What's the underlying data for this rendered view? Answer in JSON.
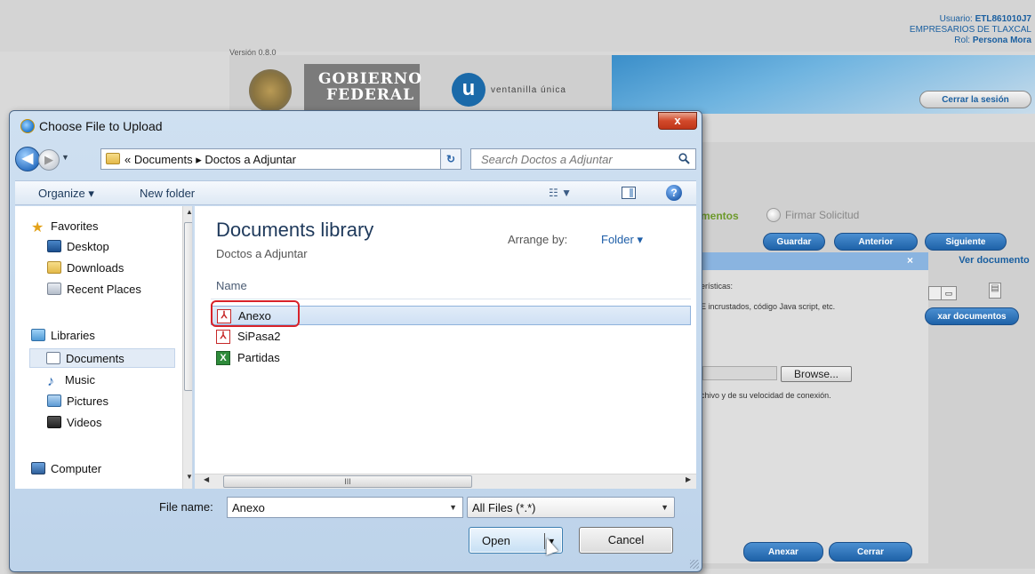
{
  "background": {
    "user_line": "Usuario: ",
    "user_id": "ETL861010J7",
    "company": "EMPRESARIOS DE TLAXCAL",
    "role_label": "Rol: ",
    "role_value": "Persona Mora",
    "version": "Versión 0.8.0",
    "brand_gob_1": "GOBIERNO",
    "brand_gob_2": "FEDERAL",
    "brand_vu_letter": "u",
    "brand_vu_text": "ventanilla única",
    "logout_label": "Cerrar la sesión",
    "step_docs": "mentos",
    "step_firmar": "Firmar Solicitud",
    "btn_guardar": "Guardar",
    "btn_anterior": "Anterior",
    "btn_siguiente": "Siguiente",
    "modal_close": "×",
    "ver_documento": "Ver documento",
    "text_caracteristicas": "erísticas:",
    "text_incrustados": "E incrustados, código Java script, etc.",
    "btn_adjuntar": "xar documentos",
    "browse_label": "Browse...",
    "text_velocidad": "chivo y de su velocidad de conexión.",
    "btn_anexar": "Anexar",
    "btn_cerrar": "Cerrar"
  },
  "dialog": {
    "title": "Choose File to Upload",
    "close_glyph": "x",
    "address_text": "«  Documents  ▸  Doctos a Adjuntar",
    "search_placeholder": "Search Doctos a Adjuntar",
    "toolbar": {
      "organize": "Organize ▾",
      "new_folder": "New folder"
    },
    "nav": [
      {
        "label": "Favorites",
        "icon": "star-icon"
      },
      {
        "label": "Desktop",
        "icon": "desktop-icon"
      },
      {
        "label": "Downloads",
        "icon": "downloads-folder-icon"
      },
      {
        "label": "Recent Places",
        "icon": "recent-places-icon"
      },
      {
        "label": "Libraries",
        "icon": "libraries-icon"
      },
      {
        "label": "Documents",
        "icon": "documents-icon"
      },
      {
        "label": "Music",
        "icon": "music-icon"
      },
      {
        "label": "Pictures",
        "icon": "pictures-icon"
      },
      {
        "label": "Videos",
        "icon": "videos-icon"
      },
      {
        "label": "Computer",
        "icon": "computer-icon"
      }
    ],
    "library_title": "Documents library",
    "library_subtitle": "Doctos a Adjuntar",
    "arrange_label": "Arrange by:",
    "arrange_value": "Folder ▾",
    "column_name": "Name",
    "files": [
      {
        "name": "Anexo",
        "type": "pdf",
        "selected": true
      },
      {
        "name": "SiPasa2",
        "type": "pdf",
        "selected": false
      },
      {
        "name": "Partidas",
        "type": "xls",
        "selected": false
      }
    ],
    "hscroll_grip": "III",
    "file_name_label": "File name:",
    "file_name_value": "Anexo",
    "file_type_value": "All Files (*.*)",
    "open_label": "Open",
    "cancel_label": "Cancel"
  },
  "colors": {
    "accent_blue": "#1e62a8",
    "highlight_red": "#d8232a",
    "step_green": "#6d9a2b"
  }
}
